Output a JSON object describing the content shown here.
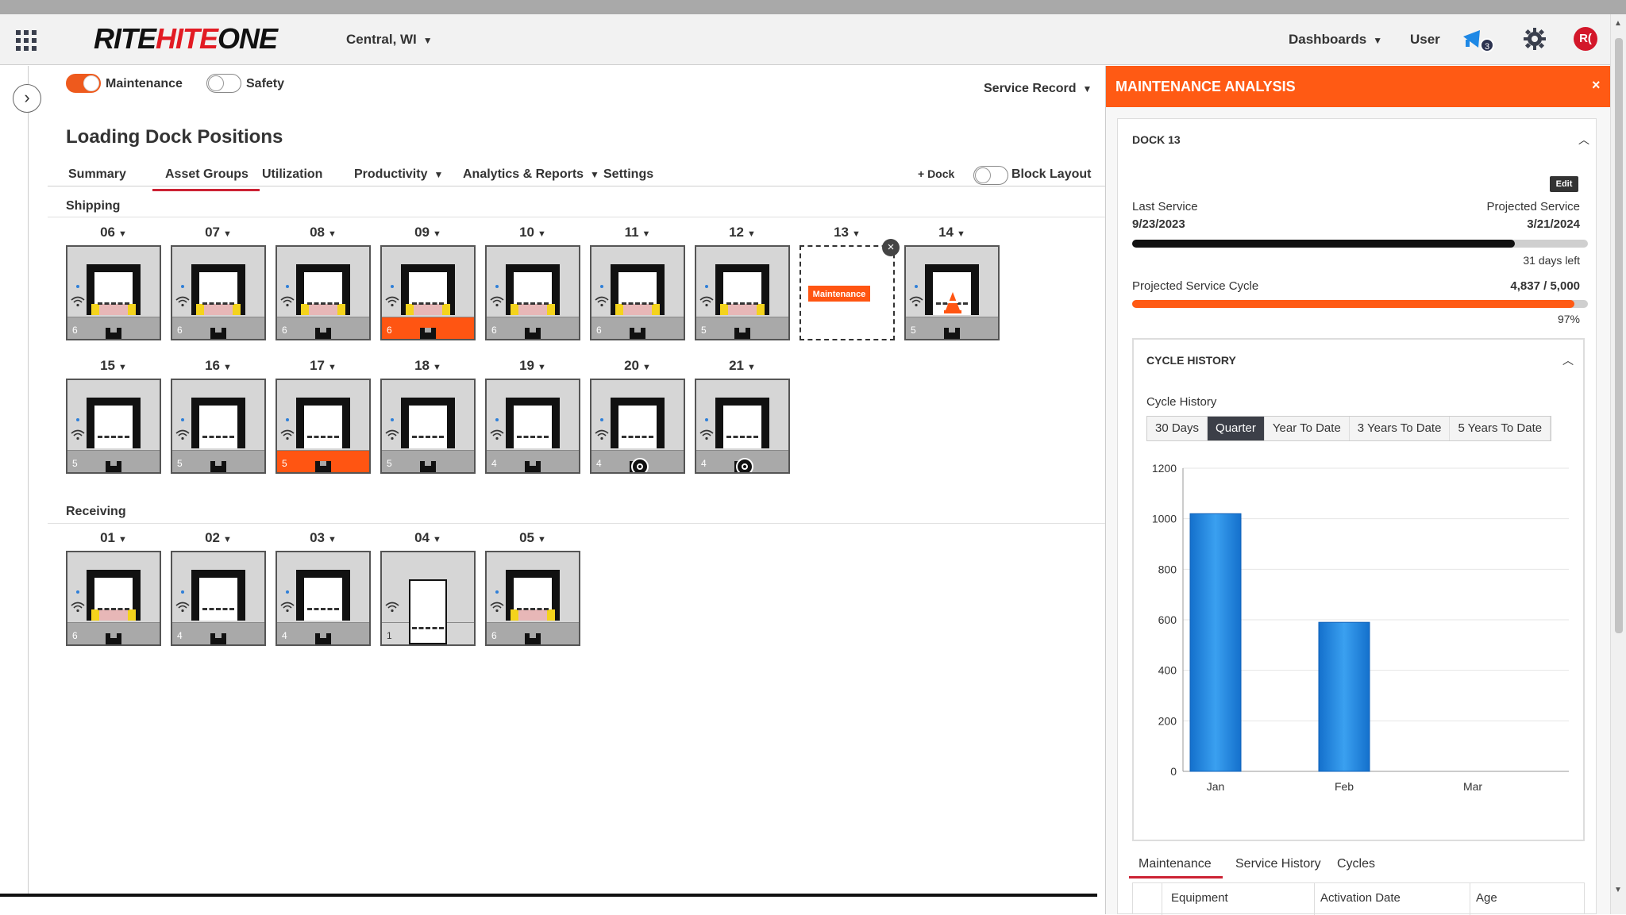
{
  "header": {
    "logo_rite": "RITE",
    "logo_hite": "HITE",
    "logo_one": "ONE",
    "location": "Central, WI",
    "dashboards": "Dashboards",
    "user": "User",
    "notification_count": "3",
    "avatar_initials": "R("
  },
  "filters": {
    "maintenance_label": "Maintenance",
    "safety_label": "Safety",
    "service_record": "Service Record"
  },
  "page": {
    "title": "Loading Dock Positions",
    "tabs": [
      {
        "label": "Summary"
      },
      {
        "label": "Asset Groups"
      },
      {
        "label": "Utilization"
      },
      {
        "label": "Productivity"
      },
      {
        "label": "Analytics & Reports"
      },
      {
        "label": "Settings"
      }
    ],
    "add_dock": "+ Dock",
    "block_layout": "Block Layout"
  },
  "groups": {
    "shipping": "Shipping",
    "receiving": "Receiving"
  },
  "docks": {
    "shipping_row1": [
      {
        "num": "06",
        "count": "6",
        "seal": true,
        "alert": false
      },
      {
        "num": "07",
        "count": "6",
        "seal": true,
        "alert": false
      },
      {
        "num": "08",
        "count": "6",
        "seal": true,
        "alert": false
      },
      {
        "num": "09",
        "count": "6",
        "seal": true,
        "alert": true
      },
      {
        "num": "10",
        "count": "6",
        "seal": true,
        "alert": false
      },
      {
        "num": "11",
        "count": "6",
        "seal": true,
        "alert": false
      },
      {
        "num": "12",
        "count": "5",
        "seal": true,
        "alert": false
      },
      {
        "num": "13",
        "maintenance": "Maintenance"
      },
      {
        "num": "14",
        "count": "5",
        "cone": true,
        "alert": false
      }
    ],
    "shipping_row2": [
      {
        "num": "15",
        "count": "5",
        "alert": false
      },
      {
        "num": "16",
        "count": "5",
        "alert": false
      },
      {
        "num": "17",
        "count": "5",
        "alert": true
      },
      {
        "num": "18",
        "count": "5",
        "alert": false
      },
      {
        "num": "19",
        "count": "4",
        "alert": false
      },
      {
        "num": "20",
        "count": "4",
        "wheel": true,
        "alert": false
      },
      {
        "num": "21",
        "count": "4",
        "wheel": true,
        "alert": false
      }
    ],
    "receiving_row": [
      {
        "num": "01",
        "count": "6",
        "seal": true,
        "alert": false
      },
      {
        "num": "02",
        "count": "4",
        "alert": false
      },
      {
        "num": "03",
        "count": "4",
        "alert": false
      },
      {
        "num": "04",
        "count": "1",
        "tall": true,
        "alert": false
      },
      {
        "num": "05",
        "count": "6",
        "seal": true,
        "alert": false
      }
    ]
  },
  "panel": {
    "title": "MAINTENANCE ANALYSIS",
    "dock": "DOCK 13",
    "edit": "Edit",
    "last_service_label": "Last Service",
    "last_service_date": "9/23/2023",
    "projected_service_label": "Projected Service",
    "projected_service_date": "3/21/2024",
    "days_left": "31 days left",
    "service_progress": 0.84,
    "cycle_label": "Projected Service Cycle",
    "cycle_value": "4,837 / 5,000",
    "cycle_percent": "97%",
    "cycle_progress": 0.97,
    "cycle_history_title": "CYCLE HISTORY",
    "cycle_history_label": "Cycle History",
    "ranges": [
      "30 Days",
      "Quarter",
      "Year To Date",
      "3 Years To Date",
      "5 Years To Date"
    ],
    "bottom_tabs": [
      "Maintenance",
      "Service History",
      "Cycles"
    ],
    "table_headers": [
      "Equipment",
      "Activation Date",
      "Age"
    ]
  },
  "colors": {
    "accent_orange": "#ff5a14",
    "brand_red": "#e21b23",
    "bar_blue": "#1f86e0",
    "alert_orange": "#ff5512"
  },
  "chart_data": {
    "type": "bar",
    "categories": [
      "Jan",
      "Feb",
      "Mar"
    ],
    "values": [
      1020,
      590,
      0
    ],
    "ylim": [
      0,
      1200
    ],
    "yticks": [
      0,
      200,
      400,
      600,
      800,
      1000,
      1200
    ],
    "grid": true
  }
}
